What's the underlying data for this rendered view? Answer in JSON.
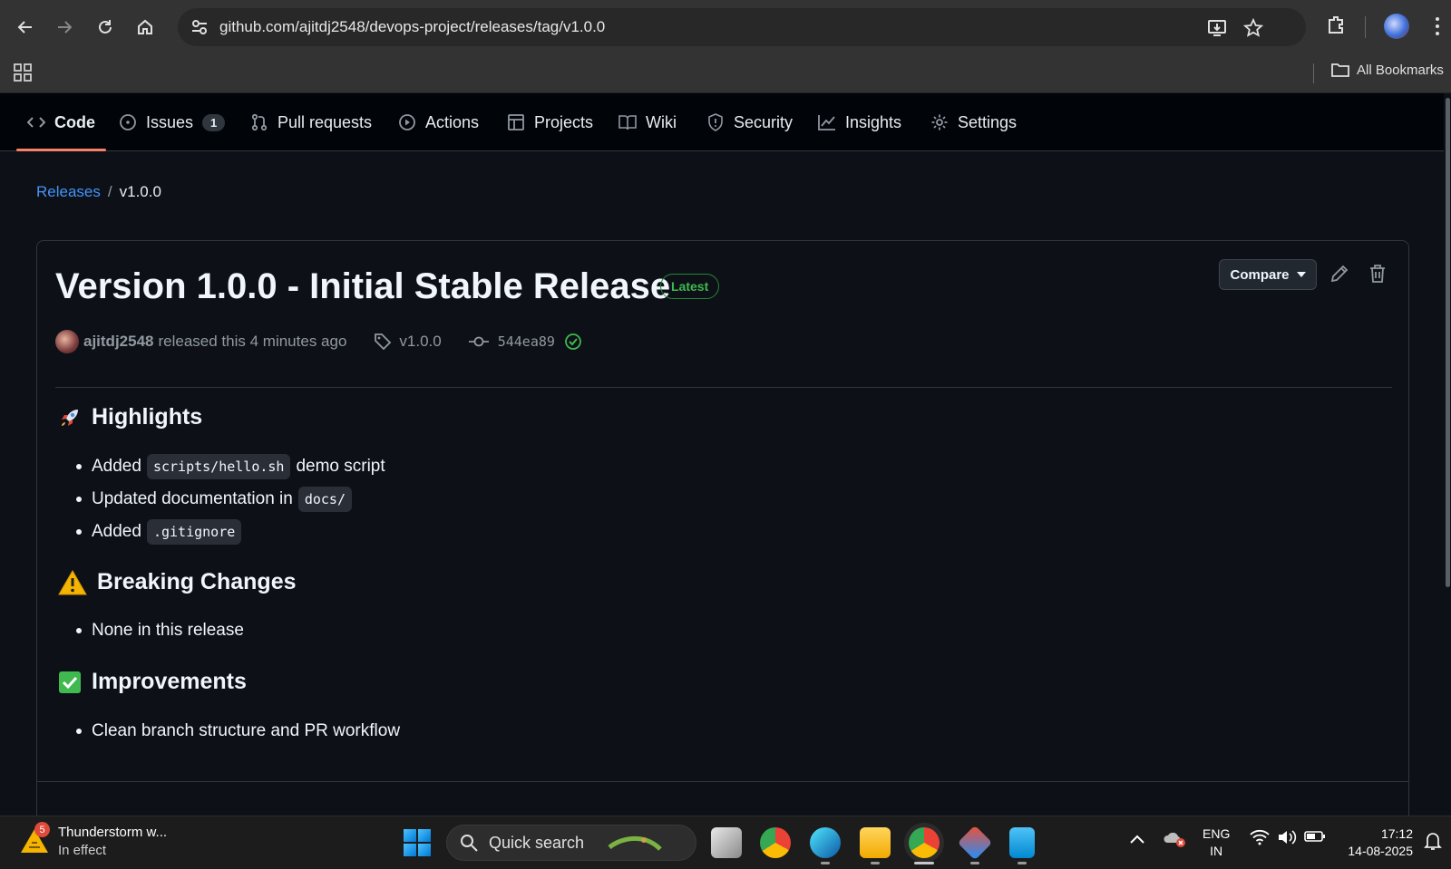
{
  "browser": {
    "url": "github.com/ajitdj2548/devops-project/releases/tag/v1.0.0",
    "bookmarks_label": "All Bookmarks"
  },
  "repo_tabs": [
    {
      "label": "Code",
      "icon": "code-icon",
      "active": true
    },
    {
      "label": "Issues",
      "icon": "issue-icon",
      "count": "1"
    },
    {
      "label": "Pull requests",
      "icon": "pull-request-icon"
    },
    {
      "label": "Actions",
      "icon": "play-icon"
    },
    {
      "label": "Projects",
      "icon": "table-icon"
    },
    {
      "label": "Wiki",
      "icon": "book-icon"
    },
    {
      "label": "Security",
      "icon": "shield-icon"
    },
    {
      "label": "Insights",
      "icon": "graph-icon"
    },
    {
      "label": "Settings",
      "icon": "gear-icon"
    }
  ],
  "breadcrumb": {
    "releases": "Releases",
    "separator": "/",
    "current": "v1.0.0"
  },
  "release": {
    "title": "Version 1.0.0 - Initial Stable Release",
    "badge": "Latest",
    "compare_label": "Compare",
    "author": "ajitdj2548",
    "released_text": "released this 4 minutes ago",
    "tag": "v1.0.0",
    "commit": "544ea89",
    "sections": {
      "highlights": {
        "title": "Highlights",
        "emoji": "rocket",
        "items": [
          {
            "before": "Added",
            "code": "scripts/hello.sh",
            "after": "demo script"
          },
          {
            "before": "Updated documentation in",
            "code": "docs/",
            "after": ""
          },
          {
            "before": "Added",
            "code": ".gitignore",
            "after": ""
          }
        ]
      },
      "breaking": {
        "title": "Breaking Changes",
        "emoji": "warning",
        "items": [
          "None in this release"
        ]
      },
      "improvements": {
        "title": "Improvements",
        "emoji": "check-mark",
        "items": [
          "Clean branch structure and PR workflow"
        ]
      }
    }
  },
  "taskbar": {
    "weather_title": "Thunderstorm w...",
    "weather_sub": "In effect",
    "weather_badge": "5",
    "search_placeholder": "Quick search",
    "lang_top": "ENG",
    "lang_bottom": "IN",
    "time": "17:12",
    "date": "14-08-2025"
  },
  "colors": {
    "accent_link": "#4493f8",
    "tab_underline": "#f78166",
    "latest_green": "#3fb950"
  }
}
